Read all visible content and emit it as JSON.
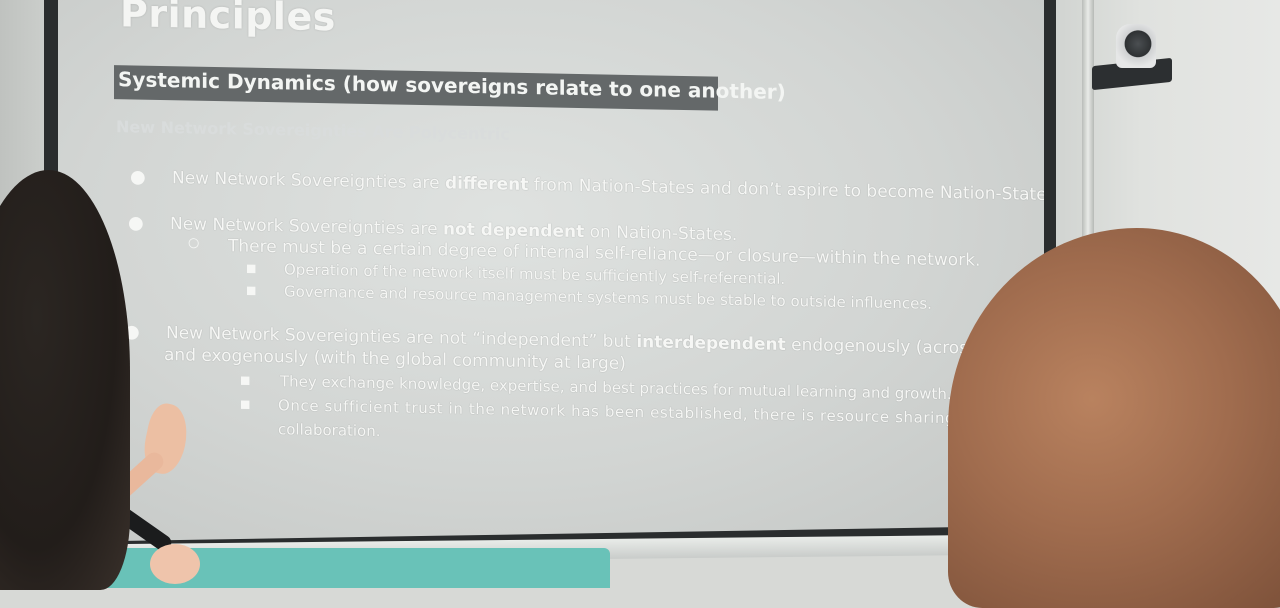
{
  "slide": {
    "title": "Principles",
    "subtitle": "Systemic Dynamics (how sovereigns relate to one another)",
    "faded_heading": "New Network Sovereignties Are Polycentric",
    "bullets": [
      {
        "level": 1,
        "marker": "●",
        "pre": "New Network Sovereignties are ",
        "bold": "different",
        "post": " from Nation-States and don’t aspire to become Nation-States."
      },
      {
        "level": 1,
        "marker": "●",
        "pre": "New Network Sovereignties are ",
        "bold": "not dependent",
        "post": " on Nation-States."
      },
      {
        "level": 2,
        "marker": "○",
        "text": "There must be a certain degree of internal self-reliance—or closure—within the network."
      },
      {
        "level": 3,
        "marker": "■",
        "text": "Operation of the network itself must be sufficiently self-referential."
      },
      {
        "level": 3,
        "marker": "■",
        "text": "Governance and resource management systems must be stable to outside influences."
      },
      {
        "level": 1,
        "marker": "●",
        "pre": "New Network Sovereignties are not “independent” but ",
        "bold": "interdependent",
        "post": " endogenously (across their nodes)",
        "continuation": "and exogenously (with the global community at large)"
      },
      {
        "level": 3,
        "marker": "■",
        "text": "They exchange knowledge, expertise, and best practices for mutual learning and growth."
      },
      {
        "level": 3,
        "marker": "■",
        "text": "Once sufficient trust in the network has been established, there is resource sharing",
        "continuation": "collaboration."
      }
    ]
  },
  "colors": {
    "screen": "#d7dad8",
    "slide_text": "#f6f7f5",
    "subtitle_band": "#5a5e60",
    "frame": "#2a2d2e",
    "table": "#69c2b8"
  },
  "scene": {
    "camera_icon": "ptz-camera-icon",
    "microphone_icon": "microphone-icon"
  }
}
